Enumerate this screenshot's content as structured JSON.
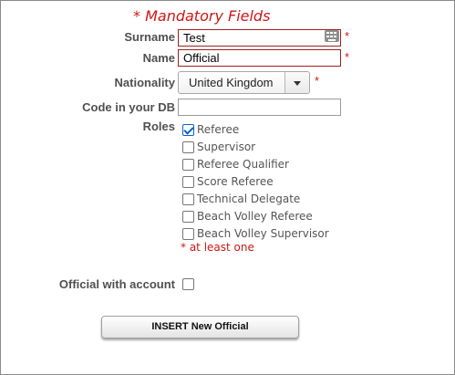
{
  "header": {
    "mandatory_note": "* Mandatory Fields"
  },
  "fields": {
    "surname": {
      "label": "Surname",
      "value": "Test",
      "required_mark": "*"
    },
    "name": {
      "label": "Name",
      "value": "Official",
      "required_mark": "*"
    },
    "nationality": {
      "label": "Nationality",
      "selected": "United Kingdom",
      "required_mark": "*"
    },
    "code": {
      "label": "Code in your DB",
      "value": ""
    }
  },
  "roles": {
    "label": "Roles",
    "items": [
      {
        "label": "Referee",
        "checked": true
      },
      {
        "label": "Supervisor",
        "checked": false
      },
      {
        "label": "Referee Qualifier",
        "checked": false
      },
      {
        "label": "Score Referee",
        "checked": false
      },
      {
        "label": "Technical Delegate",
        "checked": false
      },
      {
        "label": "Beach Volley Referee",
        "checked": false
      },
      {
        "label": "Beach Volley Supervisor",
        "checked": false
      }
    ],
    "hint": "* at least one"
  },
  "account": {
    "label": "Official with account",
    "checked": false
  },
  "actions": {
    "submit_label": "INSERT New Official"
  },
  "icons": {
    "surname_field_icon": "keyboard-icon"
  },
  "colors": {
    "required": "#d01616",
    "error_border": "#a02020",
    "checkbox_accent": "#0b63c9"
  }
}
